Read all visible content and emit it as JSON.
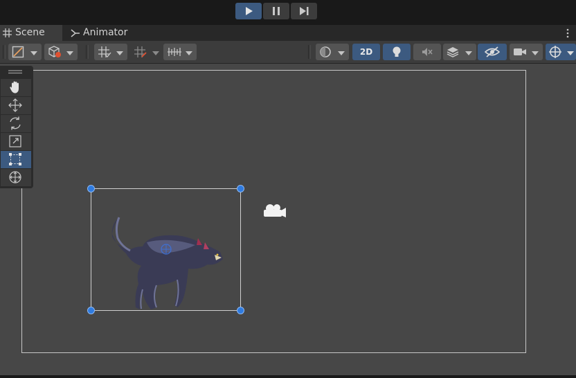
{
  "playbar": {
    "buttons": [
      {
        "name": "play",
        "active": true
      },
      {
        "name": "pause",
        "active": false
      },
      {
        "name": "step",
        "active": false
      }
    ]
  },
  "tabs": [
    {
      "label": "Scene",
      "icon": "grid-icon",
      "active": true
    },
    {
      "label": "Animator",
      "icon": "animator-icon",
      "active": false
    }
  ],
  "toolbar": {
    "mode_2d_label": "2D",
    "mode_2d_active": true
  },
  "tools": [
    {
      "name": "hand-tool",
      "active": false
    },
    {
      "name": "move-tool",
      "active": false
    },
    {
      "name": "rotate-tool",
      "active": false
    },
    {
      "name": "scale-tool",
      "active": false
    },
    {
      "name": "rect-tool",
      "active": true
    },
    {
      "name": "transform-tool",
      "active": false
    }
  ],
  "colors": {
    "accent": "#3c5a80",
    "handle": "#2f7be0",
    "scene_bg": "#474747",
    "panel_bg": "#3c3c3c"
  }
}
